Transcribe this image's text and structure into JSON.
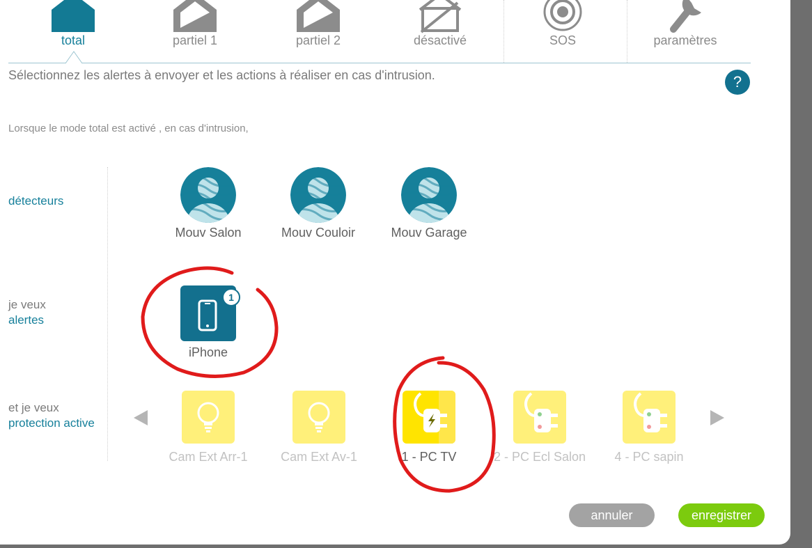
{
  "tabs": [
    {
      "label": "total",
      "icon": "house-filled-icon",
      "active": true
    },
    {
      "label": "partiel 1",
      "icon": "house-partial-icon",
      "active": false
    },
    {
      "label": "partiel 2",
      "icon": "house-partial-icon",
      "active": false
    },
    {
      "label": "désactivé",
      "icon": "house-disabled-icon",
      "active": false
    },
    {
      "label": "SOS",
      "icon": "sos-target-icon",
      "active": false
    },
    {
      "label": "paramètres",
      "icon": "wrench-icon",
      "active": false
    }
  ],
  "intro": "Sélectionnez les alertes à envoyer et les actions à réaliser en cas d'intrusion.",
  "help_label": "?",
  "subtitle": "Lorsque le mode total est activé , en cas d'intrusion,",
  "rows": {
    "detectors": {
      "label": "détecteurs"
    },
    "alerts": {
      "prefix": "je veux",
      "label": "alertes"
    },
    "actions": {
      "prefix": "et je veux",
      "label": "protection active"
    }
  },
  "detectors": [
    {
      "name": "Mouv Salon",
      "icon": "motion-sensor-person-icon"
    },
    {
      "name": "Mouv Couloir",
      "icon": "motion-sensor-person-icon"
    },
    {
      "name": "Mouv Garage",
      "icon": "motion-sensor-person-icon"
    }
  ],
  "alerts": [
    {
      "name": "iPhone",
      "badge": "1",
      "icon": "smartphone-icon",
      "selected": true
    }
  ],
  "actions": [
    {
      "name": "Cam Ext Arr-1",
      "icon": "light-bulb-icon",
      "selected": false
    },
    {
      "name": "Cam Ext Av-1",
      "icon": "light-bulb-icon",
      "selected": false
    },
    {
      "name": "1 - PC TV",
      "icon": "power-plug-icon",
      "selected": true
    },
    {
      "name": "2 - PC Ecl Salon",
      "icon": "power-plug-icon",
      "selected": false
    },
    {
      "name": "4 - PC sapin",
      "icon": "power-plug-icon",
      "selected": false
    }
  ],
  "buttons": {
    "cancel": "annuler",
    "save": "enregistrer"
  },
  "colors": {
    "accent": "#17809b",
    "accent_dark": "#13708e",
    "action_yellow": "#ffe400",
    "action_yellow_inactive": "#fff07a",
    "save_green": "#7ccb0e",
    "cancel_grey": "#a3a3a3",
    "annotation_red": "#e01b1b"
  }
}
